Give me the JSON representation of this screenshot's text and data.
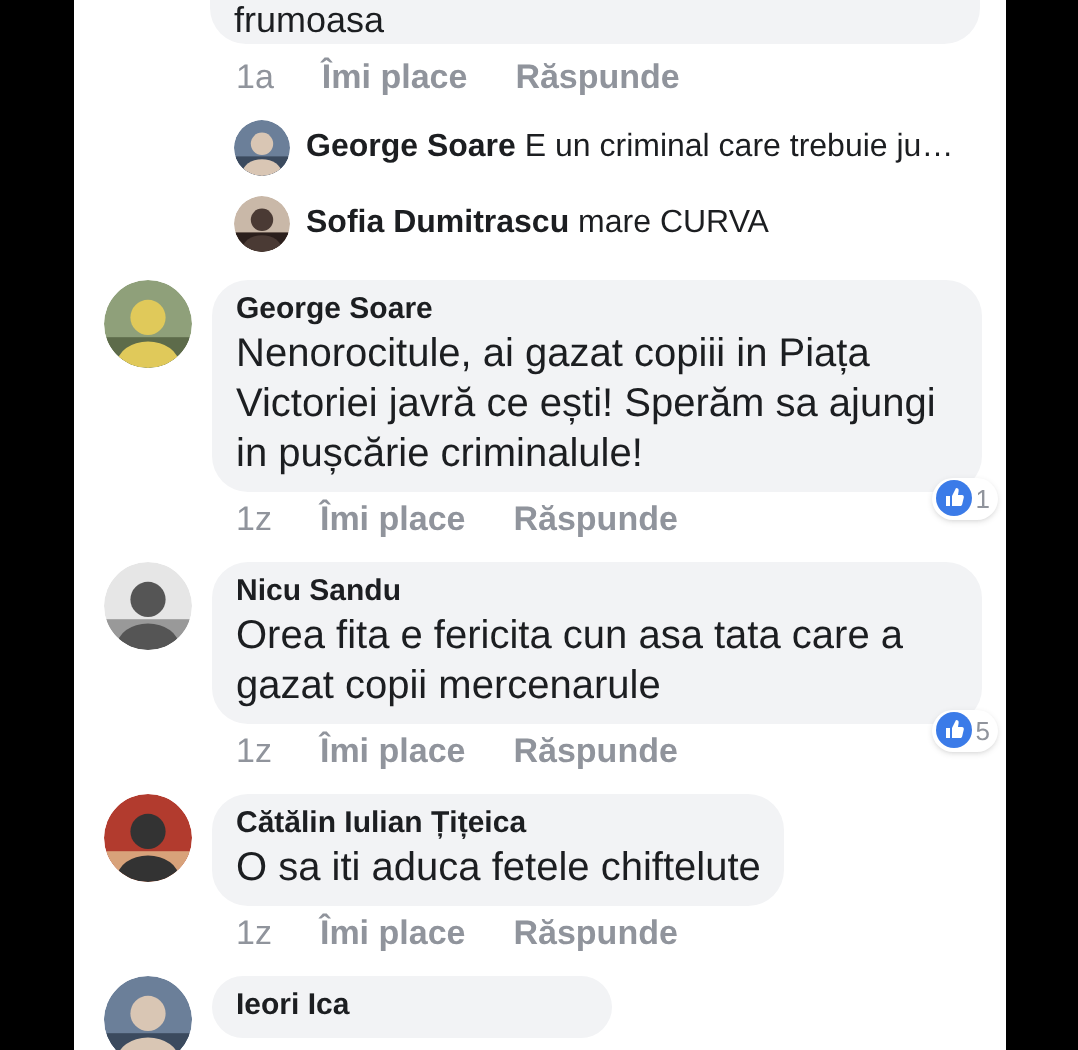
{
  "top_comment": {
    "text": "frumoasa",
    "time": "1a",
    "like": "Îmi place",
    "reply": "Răspunde",
    "replies": [
      {
        "author": "George Soare",
        "text": "E un criminal care trebuie ju…"
      },
      {
        "author": "Sofia Dumitrascu",
        "text": "mare CURVA"
      }
    ]
  },
  "comments": [
    {
      "author": "George Soare",
      "text": "Nenorocitule, ai gazat copiii in Piața Victoriei javră ce ești! Sperăm sa ajungi in pușcărie criminalule!",
      "time": "1z",
      "like": "Îmi place",
      "reply": "Răspunde",
      "reactions": "1"
    },
    {
      "author": "Nicu Sandu",
      "text": "Orea fita e fericita cun asa tata care a gazat copii mercenarule",
      "time": "1z",
      "like": "Îmi place",
      "reply": "Răspunde",
      "reactions": "5"
    },
    {
      "author": "Cătălin Iulian Țițeica",
      "text": "O sa iti aduca fetele chiftelute",
      "time": "1z",
      "like": "Îmi place",
      "reply": "Răspunde"
    },
    {
      "author": "Ieori Ica"
    }
  ]
}
